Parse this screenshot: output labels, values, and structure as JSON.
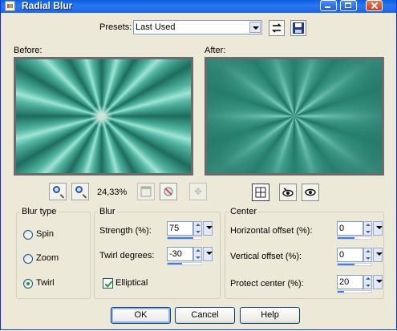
{
  "window": {
    "title": "Radial Blur"
  },
  "presets": {
    "label": "Presets:",
    "value": "Last Used"
  },
  "preview": {
    "before_label": "Before:",
    "after_label": "After:"
  },
  "zoom": {
    "level": "24,33%"
  },
  "blur_type": {
    "title": "Blur type",
    "options": [
      {
        "label": "Spin",
        "checked": false
      },
      {
        "label": "Zoom",
        "checked": false
      },
      {
        "label": "Twirl",
        "checked": true
      }
    ]
  },
  "blur": {
    "title": "Blur",
    "strength_label": "Strength (%):",
    "strength_value": "75",
    "strength_fraction": 0.75,
    "twirl_label": "Twirl degrees:",
    "twirl_value": "-30",
    "twirl_fraction": 0.42,
    "elliptical_label": "Elliptical",
    "elliptical_checked": true
  },
  "center": {
    "title": "Center",
    "h_offset_label": "Horizontal offset (%):",
    "h_offset_value": "0",
    "h_offset_fraction": 0.5,
    "v_offset_label": "Vertical offset (%):",
    "v_offset_value": "0",
    "v_offset_fraction": 0.5,
    "protect_label": "Protect center (%):",
    "protect_value": "20",
    "protect_fraction": 0.2
  },
  "buttons": {
    "ok": "OK",
    "cancel": "Cancel",
    "help": "Help"
  },
  "icons": {
    "zoom_out": "zoom-out-icon",
    "zoom_in": "zoom-in-icon",
    "proof": "proof-icon",
    "reset": "reset-icon",
    "move": "move-icon",
    "split_view": "split-view-icon",
    "auto_proof": "auto-proof-icon",
    "preview_on_image": "preview-on-image-icon"
  }
}
